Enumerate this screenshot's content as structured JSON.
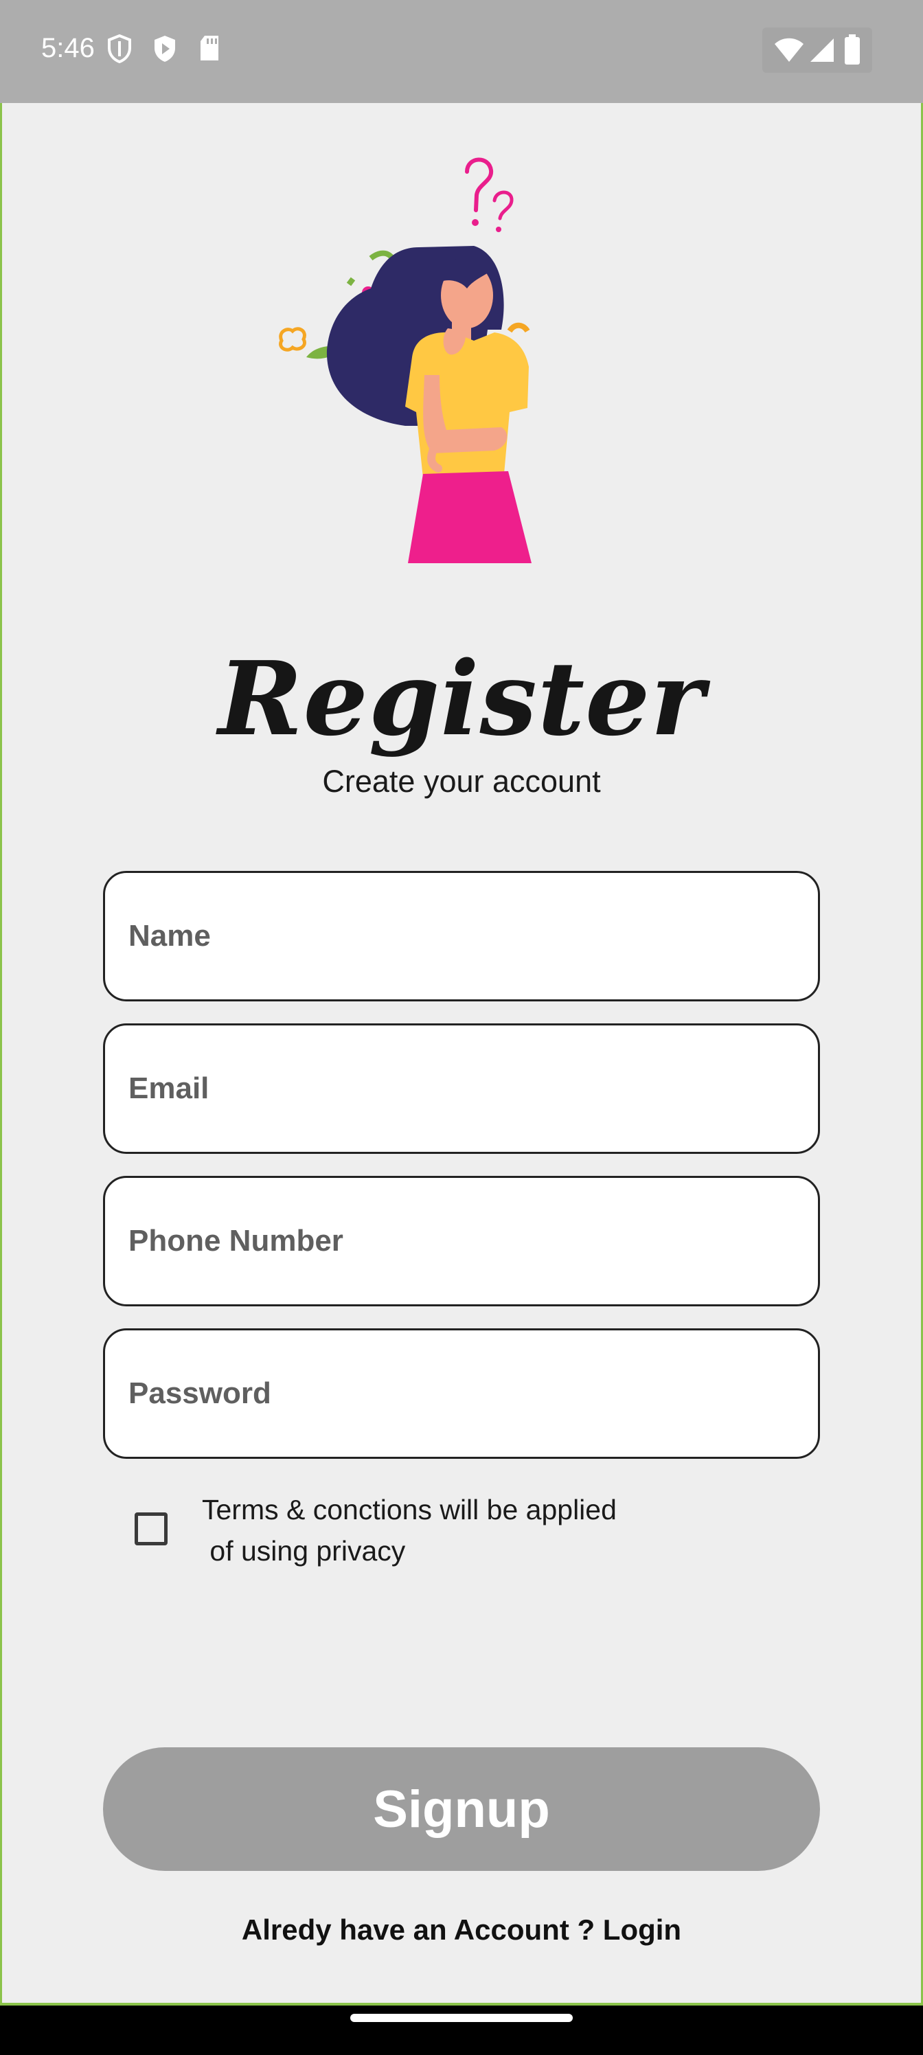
{
  "status_bar": {
    "time": "5:46",
    "icons": [
      "shield-icon",
      "play-protect-icon",
      "sd-card-icon"
    ],
    "right_icons": [
      "wifi-icon",
      "signal-icon",
      "battery-icon"
    ]
  },
  "header": {
    "title": "Register",
    "subtitle": "Create your account"
  },
  "form": {
    "name_placeholder": "Name",
    "email_placeholder": "Email",
    "phone_placeholder": "Phone Number",
    "password_placeholder": "Password",
    "terms_line1": "Terms & conctions will be applied",
    "terms_line2": " of using privacy",
    "signup_label": "Signup",
    "login_text": "Alredy have an Account ? Login"
  },
  "colors": {
    "background": "#eeeeee",
    "status_bar": "#adadad",
    "button_disabled": "#9e9e9e",
    "border_accent": "#8bc34a"
  }
}
